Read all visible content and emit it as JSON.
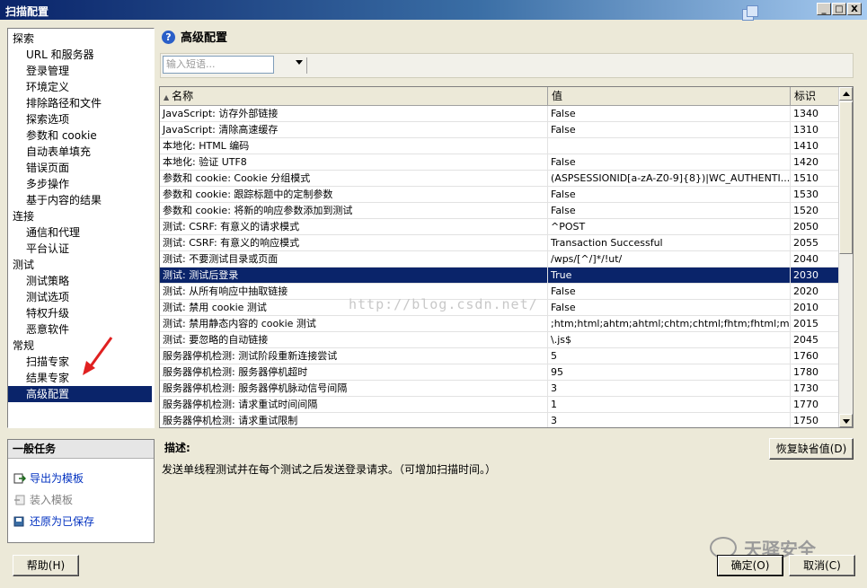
{
  "window": {
    "title": "扫描配置"
  },
  "title_buttons": [
    "_",
    "□",
    "X"
  ],
  "nav": {
    "sections": [
      {
        "label": "探索",
        "items": [
          "URL 和服务器",
          "登录管理",
          "环境定义",
          "排除路径和文件",
          "探索选项",
          "参数和 cookie",
          "自动表单填充",
          "错误页面",
          "多步操作",
          "基于内容的结果"
        ]
      },
      {
        "label": "连接",
        "items": [
          "通信和代理",
          "平台认证"
        ]
      },
      {
        "label": "测试",
        "items": [
          "测试策略",
          "测试选项",
          "特权升级",
          "恶意软件"
        ]
      },
      {
        "label": "常规",
        "items": [
          "扫描专家",
          "结果专家",
          "高级配置"
        ]
      }
    ],
    "selected": "高级配置"
  },
  "tasks": {
    "header": "一般任务",
    "items": [
      {
        "label": "导出为模板",
        "enabled": true,
        "icon": "export-icon"
      },
      {
        "label": "装入模板",
        "enabled": false,
        "icon": "load-template-icon"
      },
      {
        "label": "还原为已保存",
        "enabled": true,
        "icon": "revert-icon"
      }
    ]
  },
  "help_button": "帮助(H)",
  "page": {
    "title": "高级配置",
    "icon": "help-circle-icon"
  },
  "search": {
    "placeholder": "输入短语..."
  },
  "table": {
    "columns": [
      "名称",
      "值",
      "标识"
    ],
    "sort_indicator": "▲",
    "rows": [
      [
        "JavaScript: 访存外部链接",
        "False",
        "1340"
      ],
      [
        "JavaScript: 清除高速缓存",
        "False",
        "1310"
      ],
      [
        "本地化: HTML 编码",
        "",
        "1410"
      ],
      [
        "本地化: 验证 UTF8",
        "False",
        "1420"
      ],
      [
        "参数和 cookie: Cookie 分组模式",
        "(ASPSESSIONID[a-zA-Z0-9]{8})|WC_AUTHENTI...",
        "1510"
      ],
      [
        "参数和 cookie: 跟踪标题中的定制参数",
        "False",
        "1530"
      ],
      [
        "参数和 cookie: 将新的响应参数添加到测试",
        "False",
        "1520"
      ],
      [
        "测试: CSRF: 有意义的请求模式",
        "^POST",
        "2050"
      ],
      [
        "测试: CSRF: 有意义的响应模式",
        "Transaction Successful",
        "2055"
      ],
      [
        "测试: 不要测试目录或页面",
        "/wps/[^/]*/!ut/",
        "2040"
      ],
      [
        "测试: 测试后登录",
        "True",
        "2030"
      ],
      [
        "测试: 从所有响应中抽取链接",
        "False",
        "2020"
      ],
      [
        "测试: 禁用 cookie 测试",
        "False",
        "2010"
      ],
      [
        "测试: 禁用静态内容的 cookie 测试",
        ";htm;html;ahtm;ahtml;chtm;chtml;fhtm;fhtml;m...",
        "2015"
      ],
      [
        "测试: 要忽略的自动链接",
        "\\.js$",
        "2045"
      ],
      [
        "服务器停机检测: 测试阶段重新连接尝试",
        "5",
        "1760"
      ],
      [
        "服务器停机检测: 服务器停机超时",
        "95",
        "1780"
      ],
      [
        "服务器停机检测: 服务器停机脉动信号间隔",
        "3",
        "1730"
      ],
      [
        "服务器停机检测: 请求重试时间间隔",
        "1",
        "1770"
      ],
      [
        "服务器停机检测: 请求重试限制",
        "3",
        "1750"
      ]
    ],
    "selected_row": 10
  },
  "description": {
    "label": "描述:",
    "text": "发送单线程测试并在每个测试之后发送登录请求。（可增加扫描时间。）"
  },
  "restore_default_button": "恢复缺省值(D)",
  "ok_button": "确定(O)",
  "cancel_button": "取消(C)",
  "watermark": "http://blog.csdn.net/",
  "brand_watermark": "天驿安全",
  "colors": {
    "selection": "#0a246a",
    "titlebar": "#0a246a",
    "link": "#0030c0"
  }
}
